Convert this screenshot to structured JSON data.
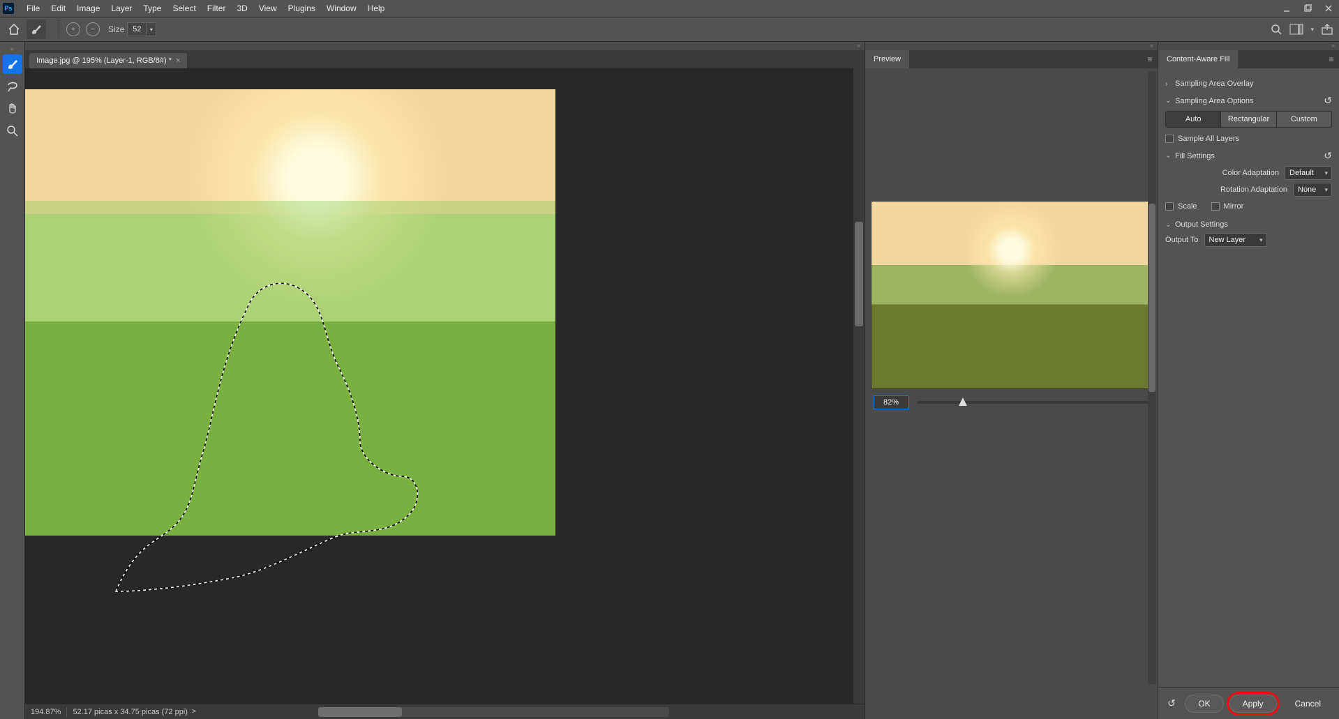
{
  "app": {
    "icon_label": "Ps"
  },
  "menu": [
    "File",
    "Edit",
    "Image",
    "Layer",
    "Type",
    "Select",
    "Filter",
    "3D",
    "View",
    "Plugins",
    "Window",
    "Help"
  ],
  "optbar": {
    "size_label": "Size",
    "size_value": "52",
    "add_mode": "+",
    "sub_mode": "−"
  },
  "document": {
    "tab_title": "Image.jpg @ 195% (Layer-1, RGB/8#) *",
    "zoom_status": "194.87%",
    "doc_info": "52.17 picas x 34.75 picas (72 ppi)"
  },
  "preview": {
    "title": "Preview",
    "zoom_value": "82%"
  },
  "caf": {
    "title": "Content-Aware Fill",
    "section_overlay": "Sampling Area Overlay",
    "section_options": "Sampling Area Options",
    "seg_auto": "Auto",
    "seg_rect": "Rectangular",
    "seg_custom": "Custom",
    "sample_all": "Sample All Layers",
    "section_fill": "Fill Settings",
    "color_adapt_label": "Color Adaptation",
    "color_adapt_value": "Default",
    "rotation_label": "Rotation Adaptation",
    "rotation_value": "None",
    "scale_label": "Scale",
    "mirror_label": "Mirror",
    "section_output": "Output Settings",
    "output_to_label": "Output To",
    "output_to_value": "New Layer",
    "btn_ok": "OK",
    "btn_apply": "Apply",
    "btn_cancel": "Cancel"
  }
}
